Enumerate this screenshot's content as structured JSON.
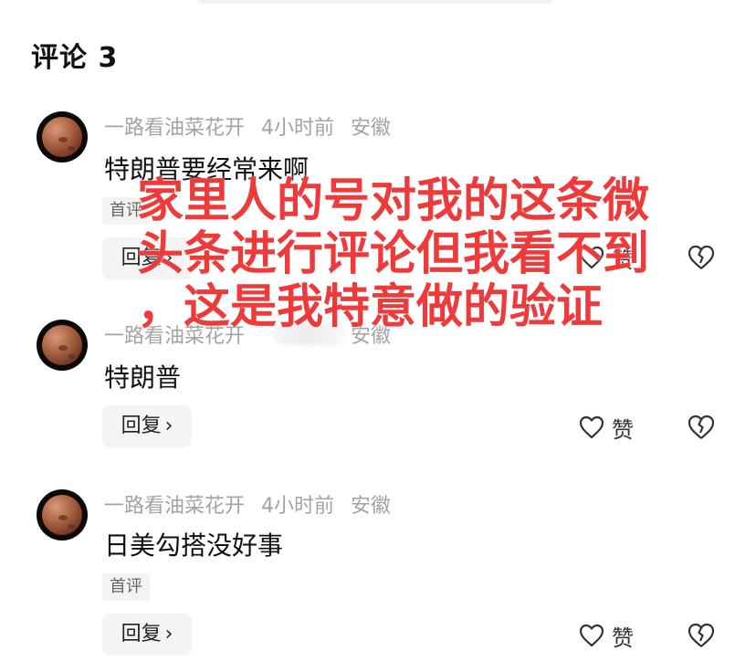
{
  "header": {
    "title": "评论 3"
  },
  "comments": [
    {
      "user": "一路看油菜花开",
      "time": "4小时前",
      "location": "安徽",
      "text": "特朗普要经常来啊",
      "tag": "首评",
      "reply_label": "回复",
      "like_label": "赞"
    },
    {
      "user": "一路看油菜花开",
      "time": "",
      "location": "安徽",
      "text": "特朗普",
      "reply_label": "回复",
      "like_label": "赞"
    },
    {
      "user": "一路看油菜花开",
      "time": "4小时前",
      "location": "安徽",
      "text": "日美勾搭没好事",
      "tag": "首评",
      "reply_label": "回复",
      "like_label": "赞"
    }
  ],
  "overlay": {
    "text": "家里人的号对我的这条微\n头条进行评论但我看不到\n，这是我特意做的验证",
    "color": "#ee3a3a"
  },
  "icons": {
    "like": "heart-outline-icon",
    "dislike": "broken-heart-icon",
    "chevron": "chevron-right-icon"
  }
}
